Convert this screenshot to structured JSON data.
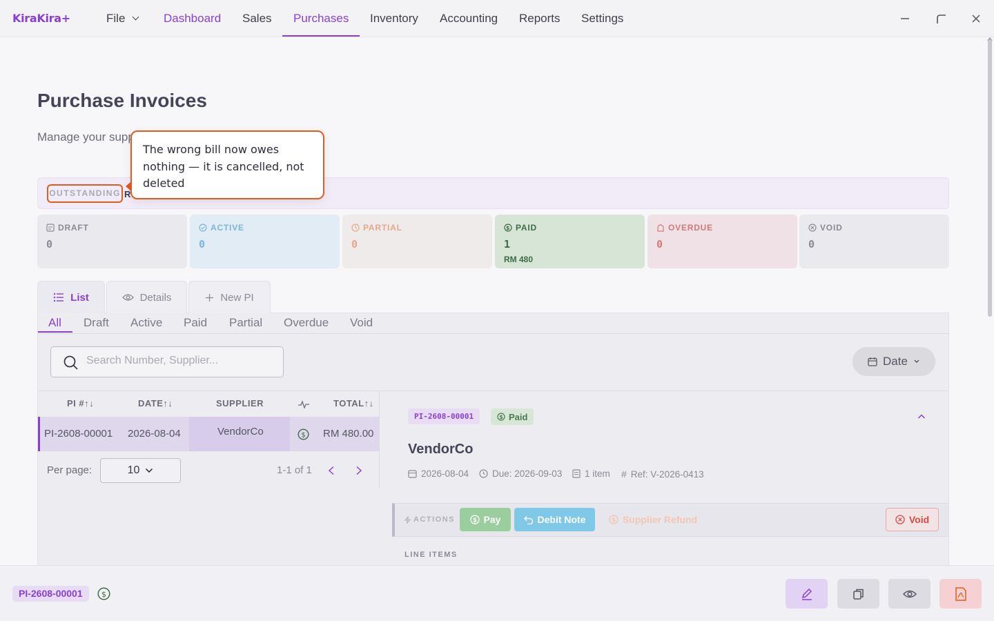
{
  "app": {
    "logo": "KiraKira+",
    "menu": [
      {
        "label": "File"
      },
      {
        "label": "Dashboard"
      },
      {
        "label": "Sales"
      },
      {
        "label": "Purchases"
      },
      {
        "label": "Inventory"
      },
      {
        "label": "Accounting"
      },
      {
        "label": "Reports"
      },
      {
        "label": "Settings"
      }
    ]
  },
  "page": {
    "title": "Purchase Invoices",
    "subtitle": "Manage your supp",
    "outstanding_label": "OUTSTANDING",
    "outstanding_value": "R"
  },
  "tooltip": {
    "text": "The wrong bill now owes nothing — it is cancelled, not deleted"
  },
  "stats": [
    {
      "label": "DRAFT",
      "count": "0",
      "amount": "",
      "color": "#8a8a96",
      "bg": "#e9e9ee",
      "icon": "draft-icon"
    },
    {
      "label": "ACTIVE",
      "count": "0",
      "amount": "",
      "color": "#7ab5dc",
      "bg": "#e2ecf4",
      "icon": "check-circle-icon"
    },
    {
      "label": "PARTIAL",
      "count": "0",
      "amount": "",
      "color": "#e3a88c",
      "bg": "#efebea",
      "icon": "clock-icon"
    },
    {
      "label": "PAID",
      "count": "1",
      "amount": "RM 480",
      "color": "#3f6b45",
      "bg": "#d6e5d6",
      "icon": "dollar-circle-icon"
    },
    {
      "label": "OVERDUE",
      "count": "0",
      "amount": "",
      "color": "#d07a7a",
      "bg": "#efe1e6",
      "icon": "alarm-icon"
    },
    {
      "label": "VOID",
      "count": "0",
      "amount": "",
      "color": "#8a8a96",
      "bg": "#e9e9ee",
      "icon": "x-circle-icon"
    }
  ],
  "view_tabs": [
    {
      "label": "List",
      "icon": "list-icon"
    },
    {
      "label": "Details",
      "icon": "eye-icon"
    },
    {
      "label": "New PI",
      "icon": "plus-icon"
    }
  ],
  "filter_tabs": [
    "All",
    "Draft",
    "Active",
    "Paid",
    "Partial",
    "Overdue",
    "Void"
  ],
  "search": {
    "placeholder": "Search Number, Supplier..."
  },
  "date_button": "Date",
  "table": {
    "headers": [
      "PI #↑↓",
      "DATE↑↓",
      "SUPPLIER",
      "",
      "TOTAL↑↓"
    ],
    "rows": [
      {
        "number": "PI-2608-00001",
        "date": "2026-08-04",
        "supplier": "VendorCo",
        "status_icon": "dollar-circle-icon",
        "total": "RM 480.00"
      }
    ]
  },
  "pager": {
    "per_page_label": "Per page:",
    "per_page_value": "10",
    "range": "1-1 of 1"
  },
  "detail": {
    "number": "PI-2608-00001",
    "status": "Paid",
    "vendor": "VendorCo",
    "date": "2026-08-04",
    "due": "Due: 2026-09-03",
    "items": "1 item",
    "ref": "Ref: V-2026-0413",
    "actions_label": "ACTIONS",
    "actions": {
      "pay": "Pay",
      "debit_note": "Debit Note",
      "supplier_refund": "Supplier Refund",
      "void": "Void"
    },
    "line_items_label": "LINE ITEMS"
  },
  "bottom": {
    "number": "PI-2608-00001"
  },
  "colors": {
    "accent": "#8a3fd1",
    "highlight": "#e25b1e"
  }
}
